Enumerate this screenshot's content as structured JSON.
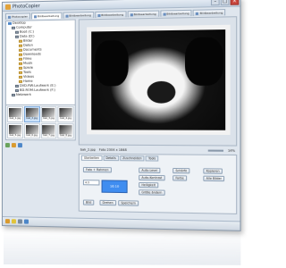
{
  "window": {
    "title": "PhotoCopier"
  },
  "tabs": [
    {
      "label": "Photocopier"
    },
    {
      "label": "Bildbearbeitung"
    },
    {
      "label": "Bildbearbeitung"
    },
    {
      "label": "Bildbearbeitung"
    },
    {
      "label": "Bildbearbeitung"
    },
    {
      "label": "Bildbearbeitung"
    },
    {
      "label": "Bildbearbeitung"
    }
  ],
  "tree": [
    {
      "label": "Desktop",
      "indent": 0,
      "icon": "desktop-icon"
    },
    {
      "label": "Computer",
      "indent": 1,
      "icon": "computer-icon"
    },
    {
      "label": "Boot (C:)",
      "indent": 2,
      "icon": "drive-icon"
    },
    {
      "label": "Data (D:)",
      "indent": 2,
      "icon": "drive-icon"
    },
    {
      "label": "Bilder",
      "indent": 3,
      "icon": "folder-icon"
    },
    {
      "label": "Daten",
      "indent": 3,
      "icon": "folder-icon"
    },
    {
      "label": "Documents",
      "indent": 3,
      "icon": "folder-icon"
    },
    {
      "label": "Downloads",
      "indent": 3,
      "icon": "folder-icon"
    },
    {
      "label": "Filme",
      "indent": 3,
      "icon": "folder-icon"
    },
    {
      "label": "Musik",
      "indent": 3,
      "icon": "folder-icon"
    },
    {
      "label": "Spiele",
      "indent": 3,
      "icon": "folder-icon"
    },
    {
      "label": "Tools",
      "indent": 3,
      "icon": "folder-icon"
    },
    {
      "label": "Videos",
      "indent": 3,
      "icon": "folder-icon"
    },
    {
      "label": "Home",
      "indent": 3,
      "icon": "folder-icon"
    },
    {
      "label": "DVD-RW-Laufwerk (E:)",
      "indent": 2,
      "icon": "drive-icon"
    },
    {
      "label": "BD-ROM-Laufwerk (F:)",
      "indent": 2,
      "icon": "drive-icon"
    },
    {
      "label": "Netzwerk",
      "indent": 1,
      "icon": "network-icon"
    }
  ],
  "thumbnails": [
    {
      "label": "bak_1.jpg"
    },
    {
      "label": "bak_2.jpg"
    },
    {
      "label": "bak_3.jpg"
    },
    {
      "label": "bak_4.jpg"
    },
    {
      "label": "bak_5.jpg"
    },
    {
      "label": "bak_6.jpg"
    },
    {
      "label": "bak_7.jpg"
    },
    {
      "label": "bak_8.jpg"
    }
  ],
  "viewer": {
    "filename": "bak_2.jpg",
    "info": "Foto 2304 x 1848",
    "zoom": "14%"
  },
  "bottom_panel": {
    "tabs": [
      "Starbeiten",
      "Details",
      "Zuschneiden",
      "Tools"
    ],
    "buttons": {
      "foto_label": "Foto + Rahmen",
      "bild_label": "Bild",
      "drehen_label": "Drehen",
      "speichern_label": "Speichern",
      "auto_label": "Auto-Level",
      "kontrast_label": "Auto-Kontrast",
      "helligkeit_label": "Helligkeit",
      "groesse_label": "Größe ändern",
      "schaerfe_label": "Schärfe",
      "farbe_label": "Farbe",
      "kopieren_label": "Kopieren",
      "nach_label": "Alle Bilder"
    },
    "color_box_label": "16:10",
    "combo_value": "4:3"
  },
  "statusbar": {
    "items": [
      "home-icon",
      "star-icon",
      "gear-icon",
      "info-icon"
    ]
  }
}
